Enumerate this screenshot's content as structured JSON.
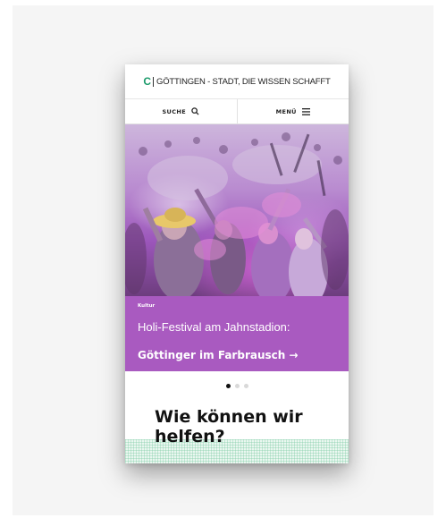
{
  "header": {
    "logo_letter": "C",
    "brand_text": "GÖTTINGEN - STADT, DIE WISSEN SCHAFFT"
  },
  "nav": {
    "search_label": "SUCHE",
    "menu_label": "MENÜ"
  },
  "hero": {
    "category": "Kultur",
    "title": "Holi-Festival am Jahnstadion:",
    "subtitle": "Göttinger im Farbrausch →"
  },
  "carousel": {
    "slides": 3,
    "active": 1
  },
  "help": {
    "title": "Wie können wir helfen?"
  },
  "colors": {
    "brand_green": "#1a9a6a",
    "caption_purple": "#a95ac0",
    "grid_mint": "#eaf7f0"
  }
}
